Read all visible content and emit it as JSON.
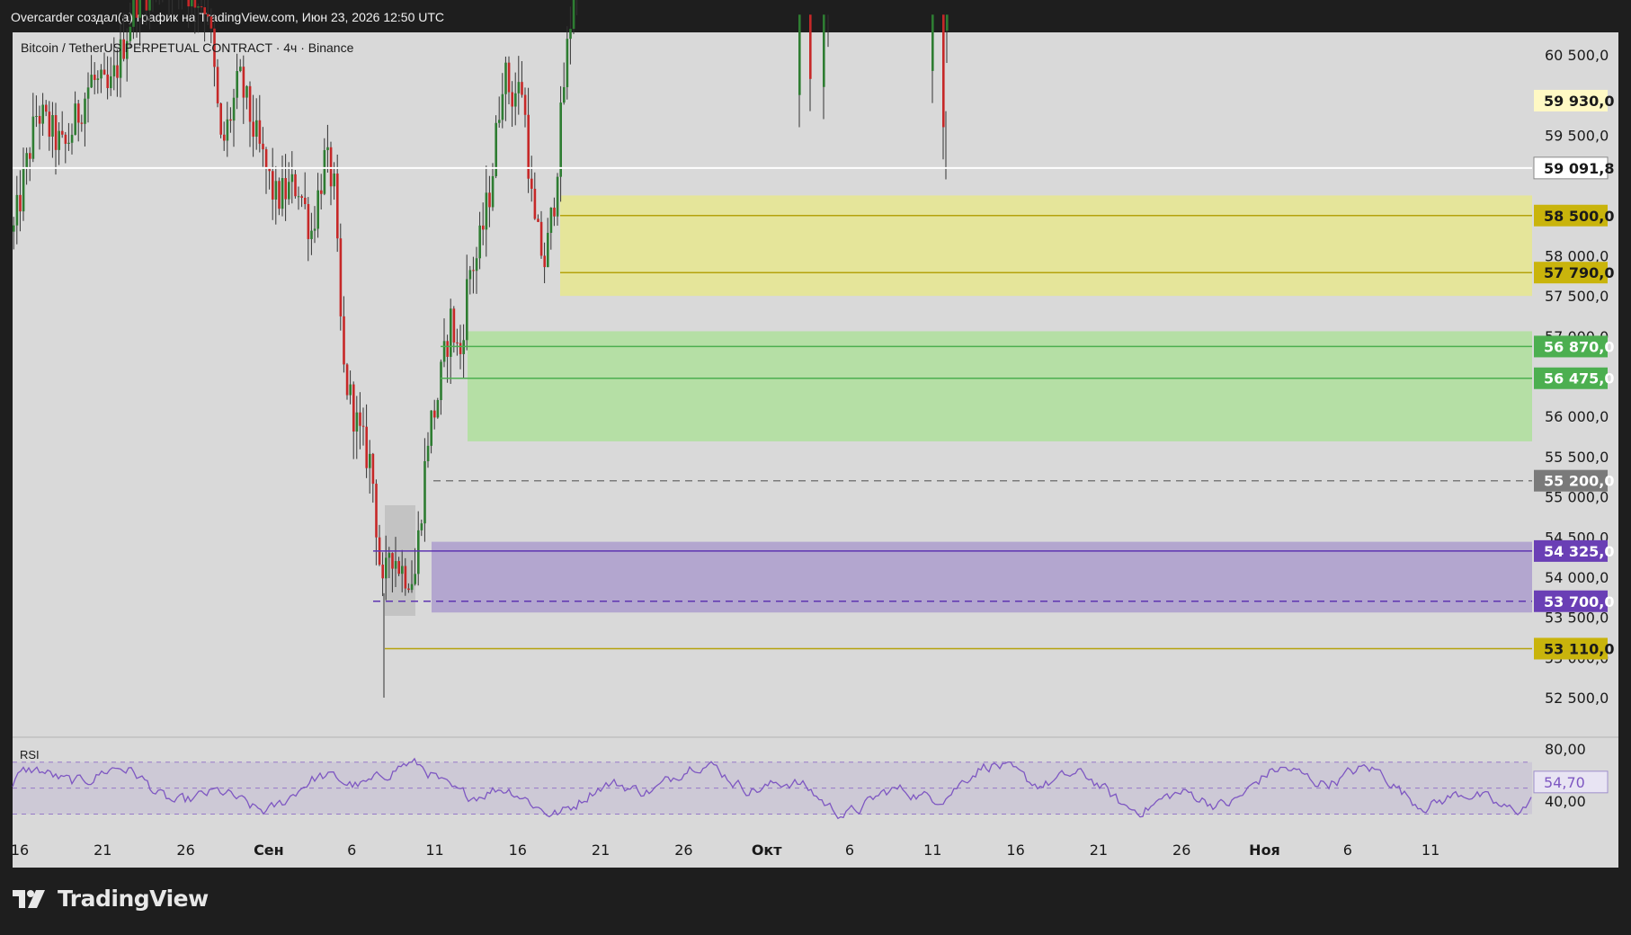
{
  "header": {
    "attribution": "Overcarder создал(а) график на TradingView.com, Июн 23, 2026 12:50 UTC"
  },
  "chart_data": {
    "type": "candlestick",
    "symbol_line": "Bitcoin / TetherUS PERPETUAL CONTRACT · 4ч · Binance",
    "timeframe": "4ч",
    "exchange": "Binance",
    "y_axis": {
      "range": [
        52100,
        61000
      ],
      "ticks": [
        "52 500,0",
        "53 000,0",
        "53 500,0",
        "54 000,0",
        "54 500,0",
        "55 000,0",
        "55 500,0",
        "56 000,0",
        "56 500,0",
        "57 000,0",
        "57 500,0",
        "58 000,0",
        "59 500,0",
        "60 500,0"
      ]
    },
    "x_axis": {
      "ticks": [
        "16",
        "21",
        "26",
        "Сен",
        "6",
        "11",
        "16",
        "21",
        "26",
        "Окт",
        "6",
        "11",
        "16",
        "21",
        "26",
        "Ноя",
        "6",
        "11"
      ]
    },
    "price_labels": [
      {
        "text": "59 930,0",
        "value": 59930,
        "style": "yellow-light"
      },
      {
        "text": "59 091,8",
        "value": 59091.8,
        "style": "white-current"
      },
      {
        "text": "58 500,0",
        "value": 58500,
        "style": "olive"
      },
      {
        "text": "57 790,0",
        "value": 57790,
        "style": "olive"
      },
      {
        "text": "56 870,0",
        "value": 56870,
        "style": "green"
      },
      {
        "text": "56 475,0",
        "value": 56475,
        "style": "green"
      },
      {
        "text": "55 200,0",
        "value": 55200,
        "style": "gray"
      },
      {
        "text": "54 325,0",
        "value": 54325,
        "style": "purple"
      },
      {
        "text": "53 700,0",
        "value": 53700,
        "style": "purple"
      },
      {
        "text": "53 110,0",
        "value": 53110,
        "style": "olive"
      }
    ],
    "zones": [
      {
        "name": "yellow-zone",
        "from": 57500,
        "to": 58750,
        "color": "#e5e59a",
        "lines": [
          58500,
          57790
        ]
      },
      {
        "name": "green-zone",
        "from": 55690,
        "to": 57060,
        "color": "#b5dfa5",
        "lines": [
          56870,
          56475
        ]
      },
      {
        "name": "purple-zone",
        "from": 53560,
        "to": 54440,
        "color": "#b3a6cf",
        "lines": [
          54325,
          53700
        ]
      }
    ],
    "horizontal_lines": [
      {
        "value": 59091.8,
        "color": "#ffffff",
        "style": "solid"
      },
      {
        "value": 55200,
        "color": "#7a7a7a",
        "style": "dashed"
      },
      {
        "value": 53110,
        "color": "#b5a20c",
        "style": "solid"
      }
    ],
    "rsi": {
      "label": "RSI",
      "value_text": "54,70",
      "value": 54.7,
      "ticks": [
        "80,00",
        "40,00"
      ],
      "upper": 70,
      "lower": 30,
      "middle": 50
    },
    "colors": {
      "up": "#2e7d32",
      "down": "#c62828",
      "background": "#d9d9d9",
      "rsi_line": "#7e57c2"
    }
  },
  "footer": {
    "brand": "TradingView"
  }
}
